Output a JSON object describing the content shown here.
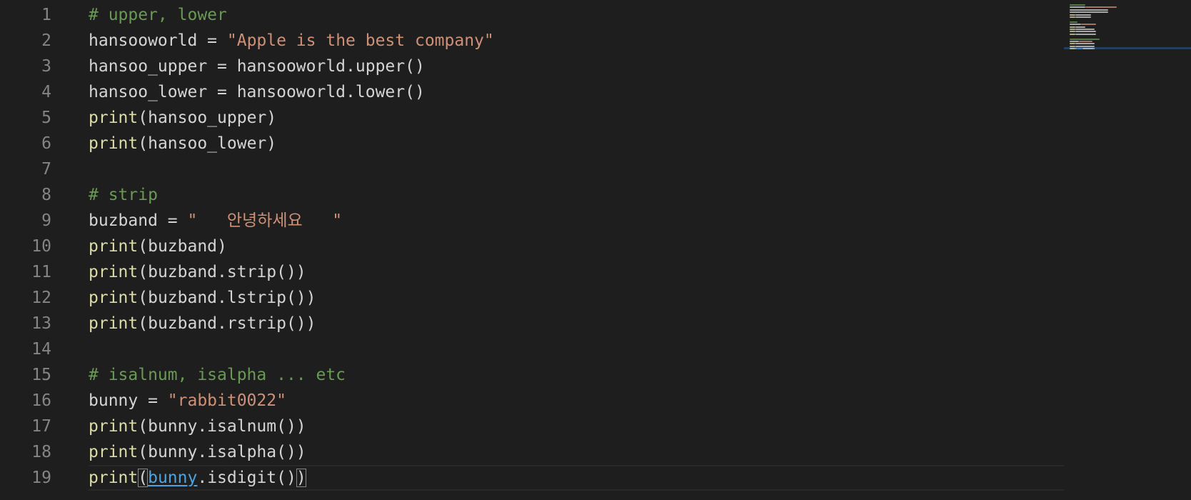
{
  "editor": {
    "language": "python",
    "current_line": 19,
    "lines": [
      {
        "no": "1",
        "tokens": [
          {
            "t": "# upper, lower",
            "k": "comment"
          }
        ]
      },
      {
        "no": "2",
        "tokens": [
          {
            "t": "hansooworld = ",
            "k": "plain"
          },
          {
            "t": "\"Apple is the best company\"",
            "k": "string"
          }
        ]
      },
      {
        "no": "3",
        "tokens": [
          {
            "t": "hansoo_upper = hansooworld.upper()",
            "k": "plain"
          }
        ]
      },
      {
        "no": "4",
        "tokens": [
          {
            "t": "hansoo_lower = hansooworld.lower()",
            "k": "plain"
          }
        ]
      },
      {
        "no": "5",
        "tokens": [
          {
            "t": "print",
            "k": "fn"
          },
          {
            "t": "(hansoo_upper)",
            "k": "plain"
          }
        ]
      },
      {
        "no": "6",
        "tokens": [
          {
            "t": "print",
            "k": "fn"
          },
          {
            "t": "(hansoo_lower)",
            "k": "plain"
          }
        ]
      },
      {
        "no": "7",
        "tokens": []
      },
      {
        "no": "8",
        "tokens": [
          {
            "t": "# strip",
            "k": "comment"
          }
        ]
      },
      {
        "no": "9",
        "tokens": [
          {
            "t": "buzband = ",
            "k": "plain"
          },
          {
            "t": "\"   안녕하세요   \"",
            "k": "string"
          }
        ]
      },
      {
        "no": "10",
        "tokens": [
          {
            "t": "print",
            "k": "fn"
          },
          {
            "t": "(buzband)",
            "k": "plain"
          }
        ]
      },
      {
        "no": "11",
        "tokens": [
          {
            "t": "print",
            "k": "fn"
          },
          {
            "t": "(buzband.strip())",
            "k": "plain"
          }
        ]
      },
      {
        "no": "12",
        "tokens": [
          {
            "t": "print",
            "k": "fn"
          },
          {
            "t": "(buzband.lstrip())",
            "k": "plain"
          }
        ]
      },
      {
        "no": "13",
        "tokens": [
          {
            "t": "print",
            "k": "fn"
          },
          {
            "t": "(buzband.rstrip())",
            "k": "plain"
          }
        ]
      },
      {
        "no": "14",
        "tokens": []
      },
      {
        "no": "15",
        "tokens": [
          {
            "t": "# isalnum, isalpha ... etc",
            "k": "comment"
          }
        ]
      },
      {
        "no": "16",
        "tokens": [
          {
            "t": "bunny = ",
            "k": "plain"
          },
          {
            "t": "\"rabbit0022\"",
            "k": "string"
          }
        ]
      },
      {
        "no": "17",
        "tokens": [
          {
            "t": "print",
            "k": "fn"
          },
          {
            "t": "(bunny.isalnum())",
            "k": "plain"
          }
        ]
      },
      {
        "no": "18",
        "tokens": [
          {
            "t": "print",
            "k": "fn"
          },
          {
            "t": "(bunny.isalpha())",
            "k": "plain"
          }
        ]
      },
      {
        "no": "19",
        "tokens": [
          {
            "t": "print",
            "k": "fn"
          },
          {
            "t": "(",
            "k": "bracket"
          },
          {
            "t": "bunny",
            "k": "hl"
          },
          {
            "t": ".isdigit()",
            "k": "plain"
          },
          {
            "t": ")",
            "k": "bracket"
          }
        ]
      }
    ]
  },
  "colors": {
    "background": "#1e1e1e",
    "comment": "#6a9955",
    "string": "#ce9178",
    "function": "#dcdcaa",
    "plain": "#d4d4d4",
    "highlight": "#4fa3e0",
    "line_number": "#858585"
  }
}
